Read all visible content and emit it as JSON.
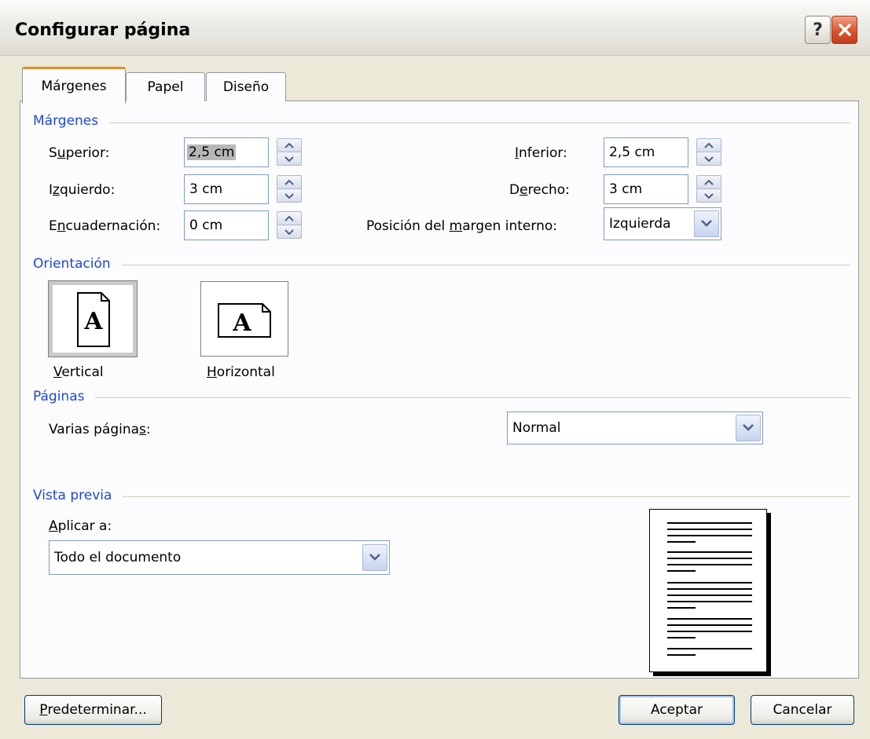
{
  "window": {
    "title": "Configurar página",
    "help_label": "?"
  },
  "tabs": [
    {
      "label": "Márgenes"
    },
    {
      "label": "Papel"
    },
    {
      "label": "Diseño"
    }
  ],
  "margins": {
    "section_label": "Márgenes",
    "superior": {
      "label_pre": "S",
      "label_u": "u",
      "label_post": "perior:",
      "value": "2,5 cm"
    },
    "izquierdo": {
      "label_pre": "I",
      "label_u": "z",
      "label_post": "quierdo:",
      "value": "3 cm"
    },
    "encuadernacion": {
      "label_pre": "E",
      "label_u": "n",
      "label_post": "cuadernación:",
      "value": "0 cm"
    },
    "inferior": {
      "label_pre": "",
      "label_u": "I",
      "label_post": "nferior:",
      "value": "2,5 cm"
    },
    "derecho": {
      "label_pre": "D",
      "label_u": "e",
      "label_post": "recho:",
      "value": "3 cm"
    },
    "posicion": {
      "label_pre": "Posición del ",
      "label_u": "m",
      "label_post": "argen interno:",
      "value": "Izquierda"
    }
  },
  "orientation": {
    "section_label": "Orientación",
    "vertical": {
      "label_u": "V",
      "label_post": "ertical",
      "glyph": "A"
    },
    "horizontal": {
      "label_u": "H",
      "label_post": "orizontal",
      "glyph": "A"
    }
  },
  "pages": {
    "section_label": "Páginas",
    "varias": {
      "label_pre": "Varias página",
      "label_u": "s",
      "label_post": ":"
    },
    "value": "Normal"
  },
  "preview": {
    "section_label": "Vista previa",
    "apply_label_u": "A",
    "apply_label_post": "plicar a:",
    "apply_value": "Todo el documento"
  },
  "buttons": {
    "default_u": "P",
    "default_post": "redeterminar...",
    "ok": "Aceptar",
    "cancel": "Cancelar"
  }
}
